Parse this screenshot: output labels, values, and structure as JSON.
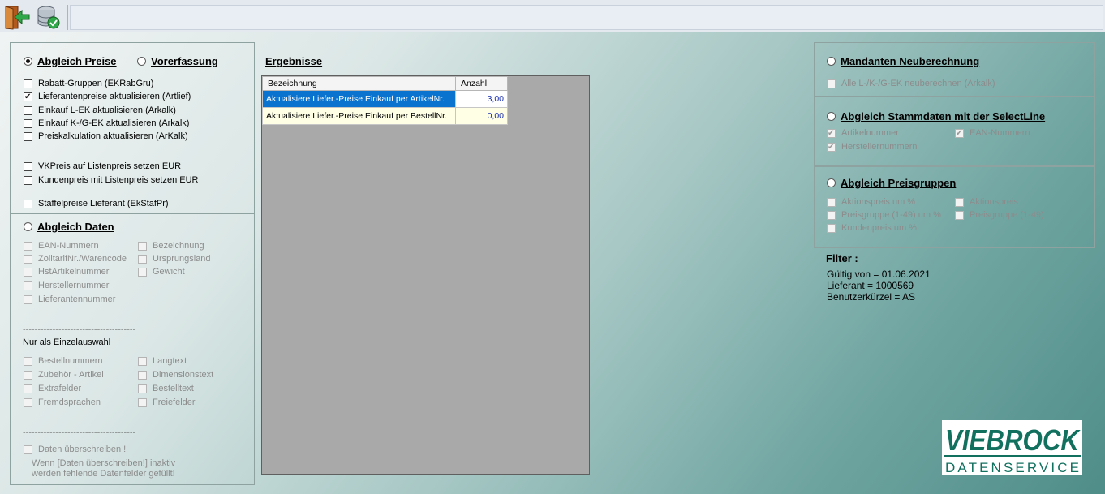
{
  "toolbar": {
    "buttons": [
      {
        "icon": "exit-door-icon"
      },
      {
        "icon": "database-check-icon"
      }
    ]
  },
  "left": {
    "abgleich_preise": {
      "label": "Abgleich Preise",
      "selected": true
    },
    "vorerfassung": {
      "label": "Vorerfassung",
      "selected": false
    },
    "price_options": [
      {
        "label": "Rabatt-Gruppen (EKRabGru)",
        "checked": false
      },
      {
        "label": "Lieferantenpreise aktualisieren (Artlief)",
        "checked": true
      },
      {
        "label": "Einkauf L-EK aktualisieren (Arkalk)",
        "checked": false
      },
      {
        "label": "Einkauf K-/G-EK aktualisieren (Arkalk)",
        "checked": false
      },
      {
        "label": "Preiskalkulation aktualisieren (ArKalk)",
        "checked": false
      },
      {
        "label": "VKPreis auf Listenpreis setzen EUR",
        "checked": false
      },
      {
        "label": "Kundenpreis mit Listenpreis setzen EUR",
        "checked": false
      },
      {
        "label": "Staffelpreise Lieferant (EkStafPr)",
        "checked": false
      }
    ],
    "abgleich_daten": {
      "label": "Abgleich Daten",
      "selected": false
    },
    "daten_left": [
      "EAN-Nummern",
      "ZolltarifNr./Warencode",
      "HstArtikelnummer",
      "Herstellernummer",
      "Lieferantennummer"
    ],
    "daten_right": [
      "Bezeichnung",
      "Ursprungsland",
      "Gewicht"
    ],
    "separator": "--------------------------------------",
    "einzelauswahl_label": "Nur als Einzelauswahl",
    "einzel_left": [
      "Bestellnummern",
      "Zubehör - Artikel",
      "Extrafelder",
      "Fremdsprachen"
    ],
    "einzel_right": [
      "Langtext",
      "Dimensionstext",
      "Bestelltext",
      "Freiefelder"
    ],
    "overwrite_label": "Daten überschreiben !",
    "overwrite_note_1": "Wenn [Daten überschreiben!] inaktiv",
    "overwrite_note_2": "werden fehlende Datenfelder gefüllt!"
  },
  "results": {
    "title": "Ergebnisse",
    "columns": [
      "Bezeichnung",
      "Anzahl"
    ],
    "rows": [
      {
        "name": "Aktualisiere Liefer.-Preise Einkauf  per ArtikelNr.",
        "count": "3,00"
      },
      {
        "name": "Aktualisiere Liefer.-Preise Einkauf  per BestellNr.",
        "count": "0,00"
      }
    ]
  },
  "right": {
    "mandanten": {
      "label": "Mandanten Neuberechnung",
      "selected": false
    },
    "mandanten_option": "Alle L-/K-/G-EK neuberechnen (Arkalk)",
    "stammdaten": {
      "label": "Abgleich Stammdaten mit der SelectLine",
      "selected": false
    },
    "stammdaten_options": [
      {
        "label": "Artikelnummer",
        "checked": true
      },
      {
        "label": "EAN-Nummern",
        "checked": true
      },
      {
        "label": "Herstellernummern",
        "checked": true
      }
    ],
    "preisgruppen": {
      "label": "Abgleich Preisgruppen",
      "selected": false
    },
    "preisgruppen_options": [
      {
        "label": "Aktionspreis um %",
        "checked": false
      },
      {
        "label": "Aktionspreis",
        "checked": false
      },
      {
        "label": "Preisgruppe (1-49) um %",
        "checked": false
      },
      {
        "label": "Preisgruppe (1-49)",
        "checked": false
      },
      {
        "label": "Kundenpreis um %",
        "checked": false
      }
    ]
  },
  "filter": {
    "title": "Filter :",
    "lines": [
      "Gültig von = 01.06.2021",
      "Lieferant  =  1000569",
      "Benutzerkürzel = AS"
    ]
  },
  "logo": {
    "brand": "VIEBROCK",
    "sub": "DATENSERVICE",
    "brand_color": "#12705f"
  }
}
